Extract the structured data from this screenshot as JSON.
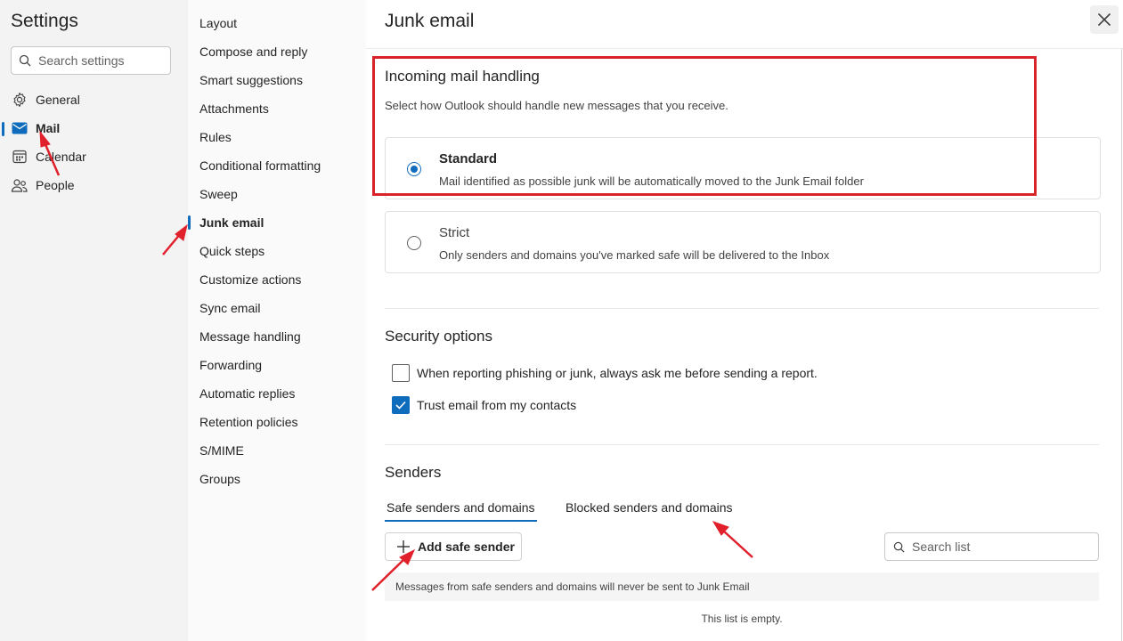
{
  "sidebar": {
    "title": "Settings",
    "search_placeholder": "Search settings",
    "items": [
      {
        "label": "General",
        "icon": "gear-icon"
      },
      {
        "label": "Mail",
        "icon": "mail-icon",
        "active": true
      },
      {
        "label": "Calendar",
        "icon": "calendar-icon"
      },
      {
        "label": "People",
        "icon": "people-icon"
      }
    ]
  },
  "subnav": {
    "items": [
      "Layout",
      "Compose and reply",
      "Smart suggestions",
      "Attachments",
      "Rules",
      "Conditional formatting",
      "Sweep",
      "Junk email",
      "Quick steps",
      "Customize actions",
      "Sync email",
      "Message handling",
      "Forwarding",
      "Automatic replies",
      "Retention policies",
      "S/MIME",
      "Groups"
    ],
    "active": "Junk email"
  },
  "main": {
    "title": "Junk email",
    "incoming": {
      "heading": "Incoming mail handling",
      "description": "Select how Outlook should handle new messages that you receive.",
      "options": [
        {
          "title": "Standard",
          "desc": "Mail identified as possible junk will be automatically moved to the Junk Email folder",
          "selected": true
        },
        {
          "title": "Strict",
          "desc": "Only senders and domains you've marked safe will be delivered to the Inbox",
          "selected": false
        }
      ]
    },
    "security": {
      "heading": "Security options",
      "options": [
        {
          "label": "When reporting phishing or junk, always ask me before sending a report.",
          "checked": false
        },
        {
          "label": "Trust email from my contacts",
          "checked": true
        }
      ]
    },
    "senders": {
      "heading": "Senders",
      "tabs": [
        "Safe senders and domains",
        "Blocked senders and domains"
      ],
      "active_tab": "Safe senders and domains",
      "add_button": "Add safe sender",
      "search_placeholder": "Search list",
      "info": "Messages from safe senders and domains will never be sent to Junk Email",
      "empty": "This list is empty."
    }
  },
  "colors": {
    "accent": "#0f6cbd",
    "annotation": "#d9232a"
  }
}
